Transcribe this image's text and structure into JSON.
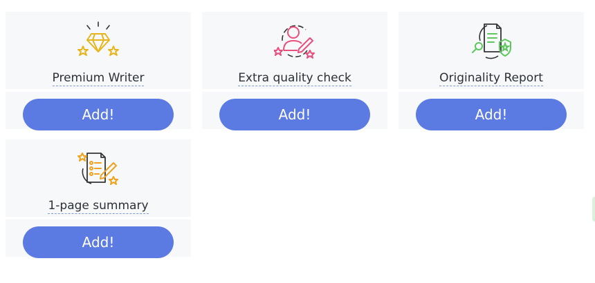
{
  "options": [
    {
      "icon": "diamond-stars-icon",
      "label": "Premium Writer",
      "button": "Add!"
    },
    {
      "icon": "writer-pencil-stars-icon",
      "label": "Extra quality check",
      "button": "Add!"
    },
    {
      "icon": "document-magnifier-shield-icon",
      "label": "Originality Report",
      "button": "Add!"
    },
    {
      "icon": "summary-checklist-pencil-icon",
      "label": "1-page summary",
      "button": "Add!"
    }
  ],
  "colors": {
    "button": "#5b7be3",
    "card_bg": "#f7f8fa",
    "diamond_icon": "#e8b41c",
    "writer_icon": "#ea4f7c",
    "originality_icon": "#5cc85c",
    "summary_icon": "#f0a21a"
  }
}
